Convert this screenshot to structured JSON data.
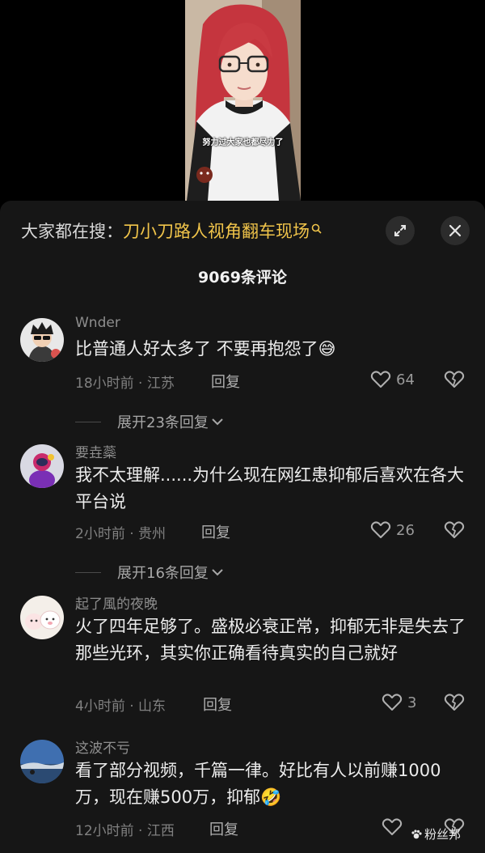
{
  "video": {
    "caption": "努力过大家也都尽力了"
  },
  "search": {
    "prefix": "大家都在搜：",
    "query": "刀小刀路人视角翻车现场",
    "icon": "search-icon"
  },
  "header": {
    "comment_count": "9069条评论"
  },
  "comments": [
    {
      "user": "Wnder",
      "text": "比普通人好太多了 不要再抱怨了😅",
      "meta": "18小时前 · 江苏",
      "reply": "回复",
      "likes": "64",
      "expand": "展开23条回复"
    },
    {
      "user": "要垚蘂",
      "text": "我不太理解......为什么现在网红患抑郁后喜欢在各大平台说",
      "meta": "2小时前 · 贵州",
      "reply": "回复",
      "likes": "26",
      "expand": "展开16条回复"
    },
    {
      "user": "起了風的夜晚",
      "text": "火了四年足够了。盛极必衰正常，抑郁无非是失去了那些光环，其实你正确看待真实的自己就好",
      "meta": "4小时前 · 山东",
      "reply": "回复",
      "likes": "3"
    },
    {
      "user": "这波不亏",
      "text": "看了部分视频，千篇一律。好比有人以前赚1000万，现在赚500万，抑郁🤣",
      "meta": "12小时前 · 江西",
      "reply": "回复",
      "likes": ""
    }
  ],
  "watermark": {
    "text": "粉丝邦"
  },
  "colors": {
    "panel_bg": "#161616",
    "search_query": "#f0c44a",
    "text_primary": "#ececec",
    "text_secondary": "#808080"
  }
}
